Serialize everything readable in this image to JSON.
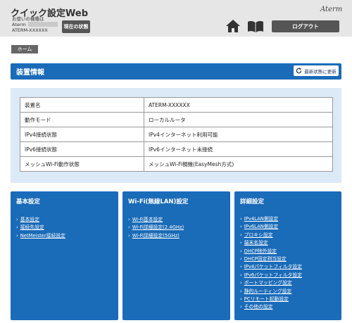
{
  "header": {
    "app_title": "クイック設定Web",
    "model_label": "お使いの機種は",
    "model_name": "Aterm",
    "model_id": "ATERM-XXXXXX",
    "status_button": "現在の状態",
    "brand": "Aterm",
    "logout_button": "ログアウト",
    "icons": [
      "home-icon",
      "book-icon"
    ]
  },
  "breadcrumb": {
    "home": "ホーム"
  },
  "device_info": {
    "title": "装置情報",
    "refresh_button": "最新状態に更新",
    "rows": [
      {
        "key": "装置名",
        "value": "ATERM-XXXXXX"
      },
      {
        "key": "動作モード",
        "value": "ローカルルータ"
      },
      {
        "key": "IPv4接続状態",
        "value": "IPv4インターネット利用可能"
      },
      {
        "key": "IPv6接続状態",
        "value": "IPv6インターネット未接続"
      },
      {
        "key": "メッシュWi-Fi動作状態",
        "value": "メッシュWi-Fi親機(EasyMesh方式)"
      }
    ]
  },
  "cards": [
    {
      "title": "基本設定",
      "links": [
        "基本設定",
        "接続先設定",
        "NetMeister接続設定"
      ]
    },
    {
      "title": "Wi-Fi(無線LAN)設定",
      "links": [
        "Wi-Fi基本設定",
        "Wi-Fi詳細設定(2.4GHz)",
        "Wi-Fi詳細設定(5GHz)"
      ]
    },
    {
      "title": "詳細設定",
      "links": [
        "IPv4LAN側設定",
        "IPv6LAN側設定",
        "プロキシ設定",
        "端末名設定",
        "DHCP除外設定",
        "DHCP固定割当設定",
        "IPv4パケットフィルタ設定",
        "IPv6パケットフィルタ設定",
        "ポートマッピング設定",
        "静的ルーティング設定",
        "PCリモート起動設定",
        "その他の設定"
      ]
    }
  ]
}
